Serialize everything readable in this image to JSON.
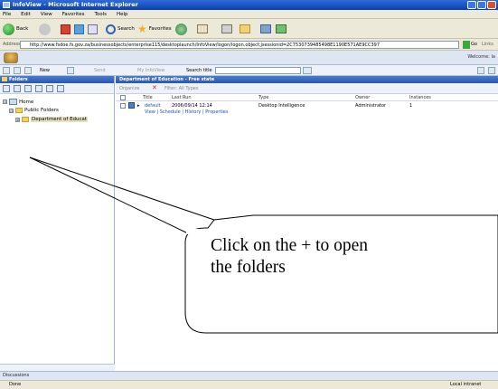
{
  "window": {
    "title": "InfoView - Microsoft Internet Explorer"
  },
  "menu": [
    "File",
    "Edit",
    "View",
    "Favorites",
    "Tools",
    "Help"
  ],
  "toolbar": {
    "back": "Back",
    "search": "Search",
    "favorites": "Favorites"
  },
  "address": {
    "label": "Address",
    "url": "http://www.fsdoe.fs.gov.za/businessobjects/enterprise115/desktoplaunch/InfoView/logon/logon.object;jsessionid=2C7530739485498E1190E571AE9CC397",
    "go": "Go",
    "links": "Links"
  },
  "brand": {
    "welcome": "Welcome: Ia"
  },
  "iv_toolbar": {
    "new": "New",
    "send": "Send",
    "my_infoview": "My InfoView",
    "search_label": "Search title"
  },
  "left": {
    "header": "Folders",
    "tree": [
      {
        "label": "Home",
        "toggle": "⊟"
      },
      {
        "label": "Public Folders",
        "toggle": "⊟"
      },
      {
        "label": "Department of Educat",
        "toggle": "⊞"
      }
    ]
  },
  "right": {
    "header": "Department of Education - Free state",
    "tools": {
      "organize": "Organize",
      "filter": "Filter: All Types"
    },
    "columns": [
      "Title",
      "Last Run",
      "Type",
      "Owner",
      "Instances"
    ],
    "rows": [
      {
        "title": "default",
        "last_run": "2006/09/14 12:14",
        "type": "Desktop Intelligence",
        "owner": "Administrator",
        "instances": "1",
        "actions": "View | Schedule | History | Properties"
      }
    ]
  },
  "discussions": "Discussions",
  "status": {
    "left": "Done",
    "zone": "Local intranet"
  },
  "callout": {
    "line1": "Click on the + to open",
    "line2": "the folders"
  }
}
